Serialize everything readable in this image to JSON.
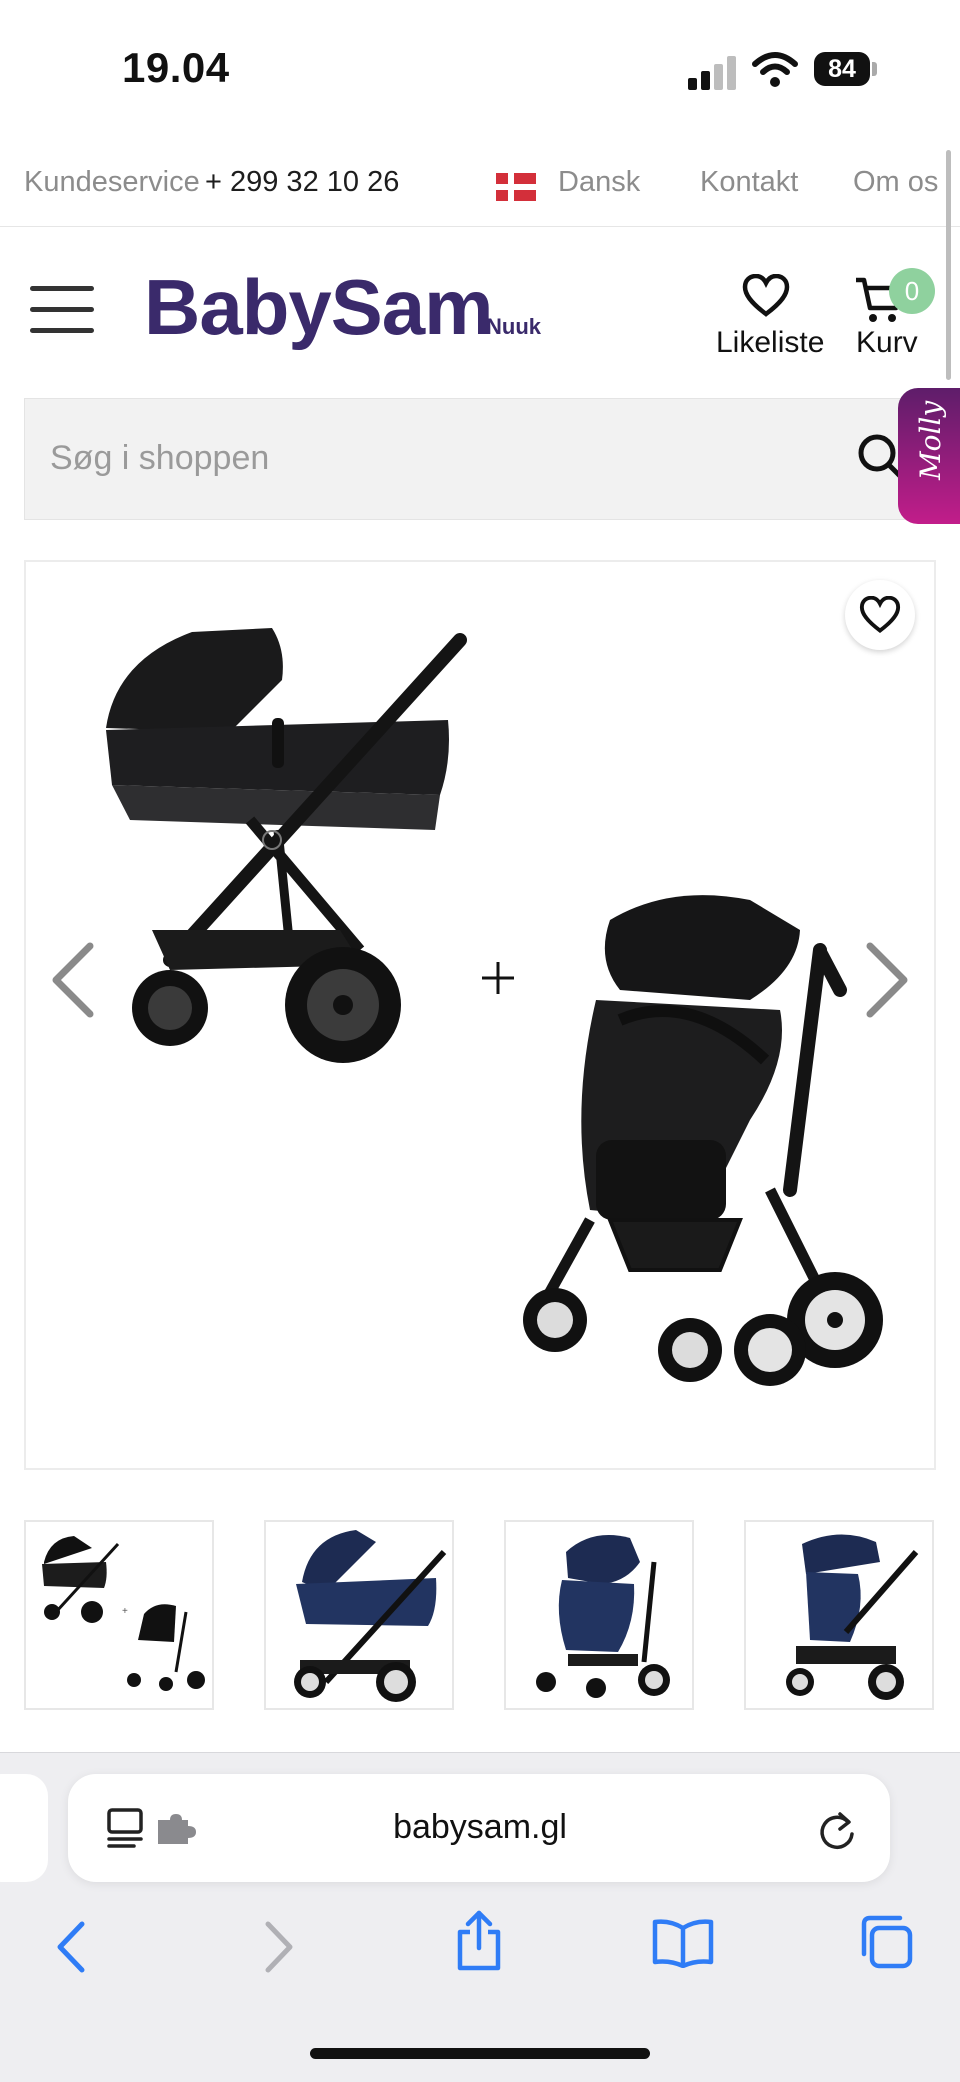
{
  "status_bar": {
    "time": "19.04",
    "battery": "84"
  },
  "topbar": {
    "customer_service": "Kundeservice",
    "phone": "+ 299 32 10 26",
    "language": "Dansk",
    "contact": "Kontakt",
    "about": "Om os"
  },
  "header": {
    "logo": "BabySam",
    "location": "Nuuk",
    "wishlist_label": "Likeliste",
    "cart_label": "Kurv",
    "cart_count": "0"
  },
  "search": {
    "placeholder": "Søg i shoppen",
    "molly_label": "Molly"
  },
  "product": {
    "thumbnail_notes": [
      "Navy Blue Cot",
      "Navy Blue Seat"
    ]
  },
  "browser": {
    "url": "babysam.gl"
  },
  "colors": {
    "brand": "#3a2a6b",
    "badge": "#8fd19e",
    "molly": "#c21d8a",
    "ios_blue": "#2f7cf6"
  }
}
